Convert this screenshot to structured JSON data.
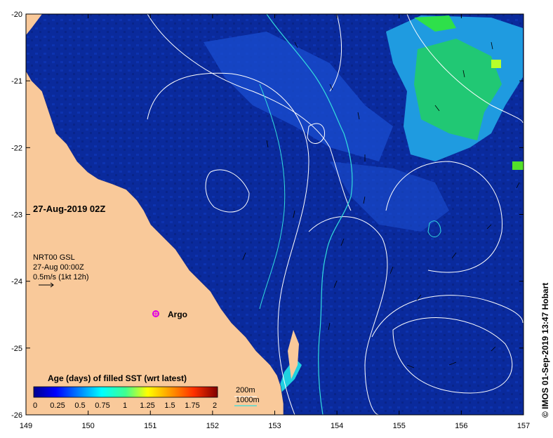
{
  "map": {
    "lon_range": [
      149,
      157
    ],
    "lat_range": [
      -26,
      -20
    ],
    "x_ticks": [
      "149",
      "150",
      "151",
      "152",
      "153",
      "154",
      "155",
      "156",
      "157"
    ],
    "y_ticks": [
      "-20",
      "-21",
      "-22",
      "-23",
      "-24",
      "-25",
      "-26"
    ],
    "colors": {
      "land": "#f9c99a",
      "ocean_age0": "#0a2a9c",
      "ocean_age_low": "#1a4ed0",
      "ocean_age_mid": "#1f9be0",
      "ocean_age_high": "#21c874",
      "shallow": "#1fd0e0",
      "isobath_200m": "#ffffff",
      "isobath_1000m": "#33dddd"
    }
  },
  "labels": {
    "date_title": "27-Aug-2019 02Z",
    "product": "NRT00 GSL",
    "valid_time": "27-Aug 00:00Z",
    "vector_scale": "0.5m/s (1kt 12h)",
    "argo_label": "Argo",
    "colorbar_title": "Age (days) of filled SST (wrt latest)",
    "colorbar_ticks": [
      "0",
      "0.25",
      "0.5",
      "0.75",
      "1",
      "1.25",
      "1.5",
      "1.75",
      "2"
    ],
    "legend_200m": "200m",
    "legend_1000m": "1000m",
    "credit": "© IMOS 01-Sep-2019 13:47 Hobart"
  }
}
